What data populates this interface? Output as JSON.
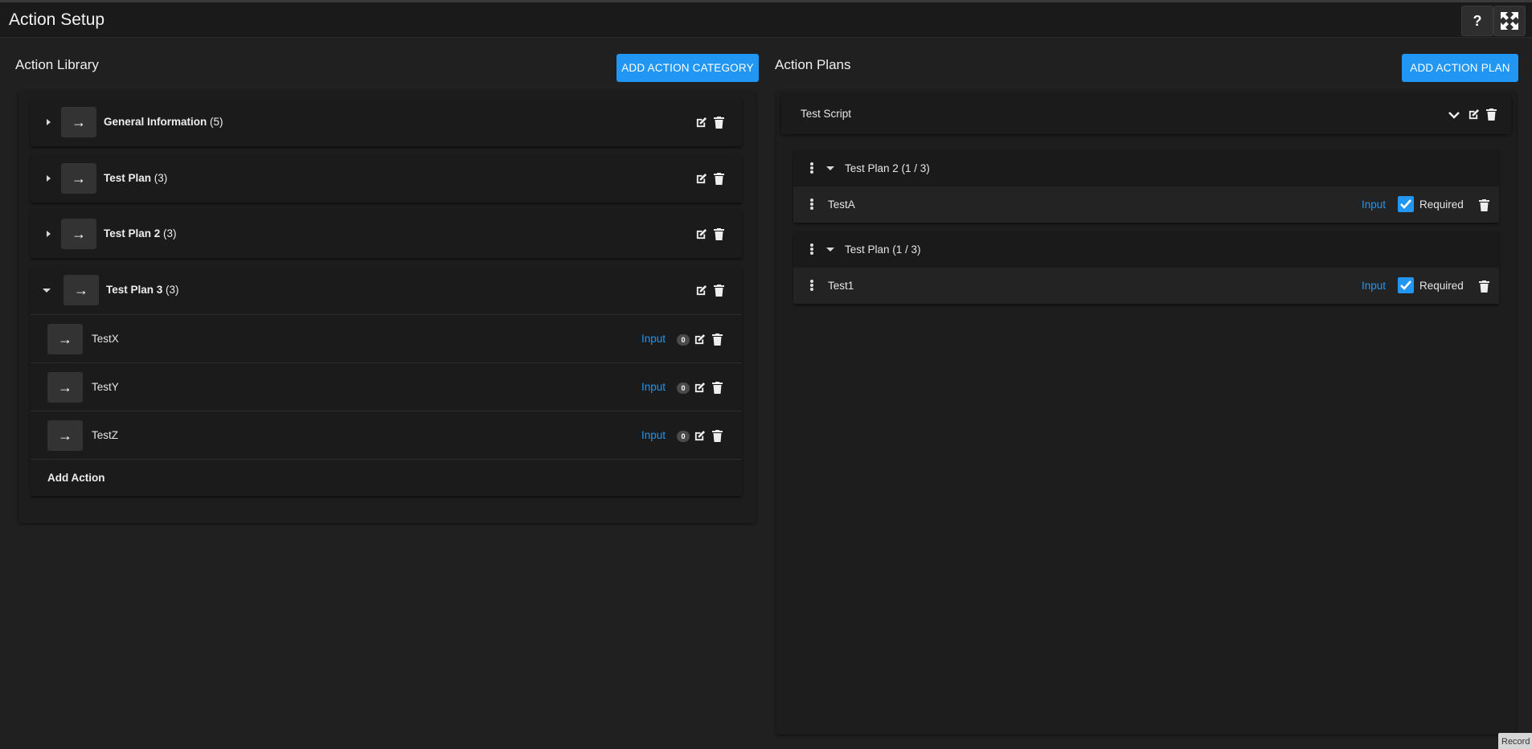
{
  "header": {
    "title": "Action Setup",
    "help_label": "?"
  },
  "library": {
    "title": "Action Library",
    "add_category_label": "ADD ACTION CATEGORY",
    "categories": [
      {
        "name": "General Information",
        "count": "(5)",
        "expanded": false
      },
      {
        "name": "Test Plan",
        "count": "(3)",
        "expanded": false
      },
      {
        "name": "Test Plan 2",
        "count": "(3)",
        "expanded": false
      },
      {
        "name": "Test Plan 3",
        "count": "(3)",
        "expanded": true
      }
    ],
    "actions": [
      {
        "name": "TestX",
        "type": "Input",
        "count": "0"
      },
      {
        "name": "TestY",
        "type": "Input",
        "count": "0"
      },
      {
        "name": "TestZ",
        "type": "Input",
        "count": "0"
      }
    ],
    "add_action_label": "Add Action"
  },
  "plans": {
    "title": "Action Plans",
    "add_plan_label": "ADD ACTION PLAN",
    "script_name": "Test Script",
    "groups": [
      {
        "name": "Test Plan 2 (1 / 3)",
        "item": "TestA",
        "type": "Input",
        "required_label": "Required",
        "required": true
      },
      {
        "name": "Test Plan (1 / 3)",
        "item": "Test1",
        "type": "Input",
        "required_label": "Required",
        "required": true
      }
    ]
  },
  "record_label": "Record",
  "icons": [
    "help-icon",
    "fullscreen-icon",
    "arrow-right-icon",
    "edit-icon",
    "trash-icon",
    "caret-right-icon",
    "caret-down-icon",
    "chevron-down-icon",
    "drag-handle-icon",
    "checkbox-checked-icon"
  ],
  "colors": {
    "accent": "#2196f3",
    "background": "#202020",
    "header": "#1a1a1a"
  }
}
